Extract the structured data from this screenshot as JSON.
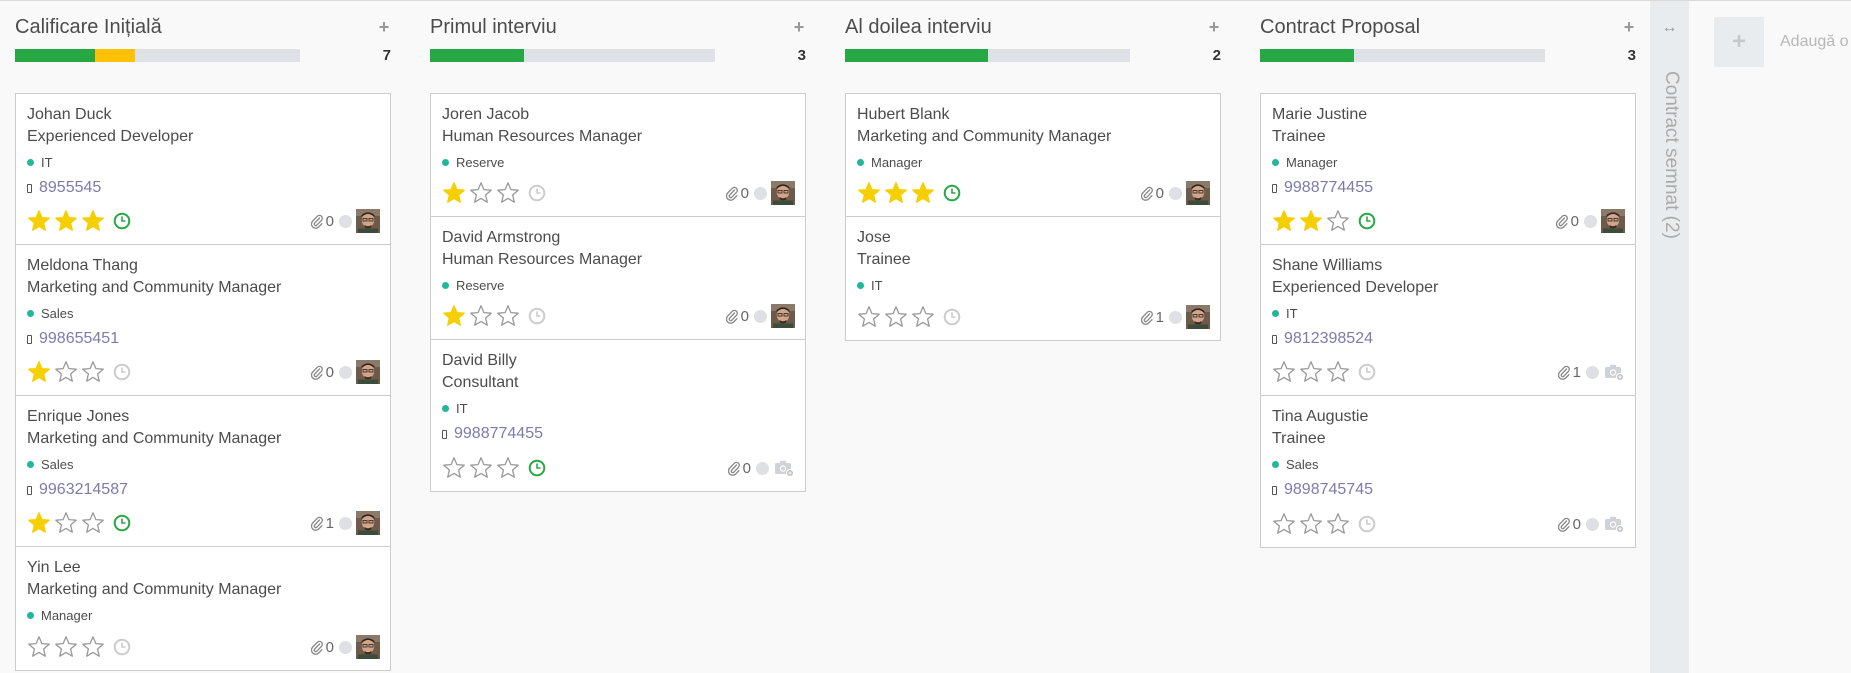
{
  "colors": {
    "green": "#28a745",
    "yellow": "#ffc107",
    "star": "#f5cf00",
    "link": "#7c7bad",
    "tag": "#21b799"
  },
  "columns": [
    {
      "title": "Calificare Inițială",
      "add_icon": "+",
      "count": "7",
      "progress": {
        "green": 0.28,
        "yellow": 0.14
      },
      "cards": [
        {
          "name": "Johan Duck",
          "job": "Experienced Developer",
          "tag": "IT",
          "phone": "8955545",
          "stars": 3,
          "clock": "active",
          "attachments": "0",
          "avatar": "photo"
        },
        {
          "name": "Meldona Thang",
          "job": "Marketing and Community Manager",
          "tag": "Sales",
          "phone": "998655451",
          "stars": 1,
          "clock": "inactive",
          "attachments": "0",
          "avatar": "photo"
        },
        {
          "name": "Enrique Jones",
          "job": "Marketing and Community Manager",
          "tag": "Sales",
          "phone": "9963214587",
          "stars": 1,
          "clock": "active",
          "attachments": "1",
          "avatar": "photo"
        },
        {
          "name": "Yin Lee",
          "job": "Marketing and Community Manager",
          "tag": "Manager",
          "phone": "",
          "stars": 0,
          "clock": "inactive",
          "attachments": "0",
          "avatar": "photo"
        }
      ]
    },
    {
      "title": "Primul interviu",
      "add_icon": "+",
      "count": "3",
      "progress": {
        "green": 0.33,
        "yellow": 0
      },
      "cards": [
        {
          "name": "Joren Jacob",
          "job": "Human Resources Manager",
          "tag": "Reserve",
          "phone": "",
          "stars": 1,
          "clock": "inactive",
          "attachments": "0",
          "avatar": "photo"
        },
        {
          "name": "David Armstrong",
          "job": "Human Resources Manager",
          "tag": "Reserve",
          "phone": "",
          "stars": 1,
          "clock": "inactive",
          "attachments": "0",
          "avatar": "photo"
        },
        {
          "name": "David Billy",
          "job": "Consultant",
          "tag": "IT",
          "phone": "9988774455",
          "stars": 0,
          "clock": "active",
          "attachments": "0",
          "avatar": "camera"
        }
      ]
    },
    {
      "title": "Al doilea interviu",
      "add_icon": "+",
      "count": "2",
      "progress": {
        "green": 0.5,
        "yellow": 0
      },
      "cards": [
        {
          "name": "Hubert Blank",
          "job": "Marketing and Community Manager",
          "tag": "Manager",
          "phone": "",
          "stars": 3,
          "clock": "active",
          "attachments": "0",
          "avatar": "photo"
        },
        {
          "name": "Jose",
          "job": "Trainee",
          "tag": "IT",
          "phone": "",
          "stars": 0,
          "clock": "inactive",
          "attachments": "1",
          "avatar": "photo"
        }
      ]
    },
    {
      "title": "Contract Proposal",
      "add_icon": "+",
      "count": "3",
      "progress": {
        "green": 0.33,
        "yellow": 0
      },
      "cards": [
        {
          "name": "Marie Justine",
          "job": "Trainee",
          "tag": "Manager",
          "phone": "9988774455",
          "stars": 2,
          "clock": "active",
          "attachments": "0",
          "avatar": "photo"
        },
        {
          "name": "Shane Williams",
          "job": "Experienced Developer",
          "tag": "IT",
          "phone": "9812398524",
          "stars": 0,
          "clock": "inactive",
          "attachments": "1",
          "avatar": "camera"
        },
        {
          "name": "Tina Augustie",
          "job": "Trainee",
          "tag": "Sales",
          "phone": "9898745745",
          "stars": 0,
          "clock": "inactive",
          "attachments": "0",
          "avatar": "camera"
        }
      ]
    }
  ],
  "folded_column": {
    "label": "Contract semnat (2)",
    "arrow": "↔"
  },
  "add_column": {
    "icon": "+",
    "label": "Adaugă o coloană"
  }
}
